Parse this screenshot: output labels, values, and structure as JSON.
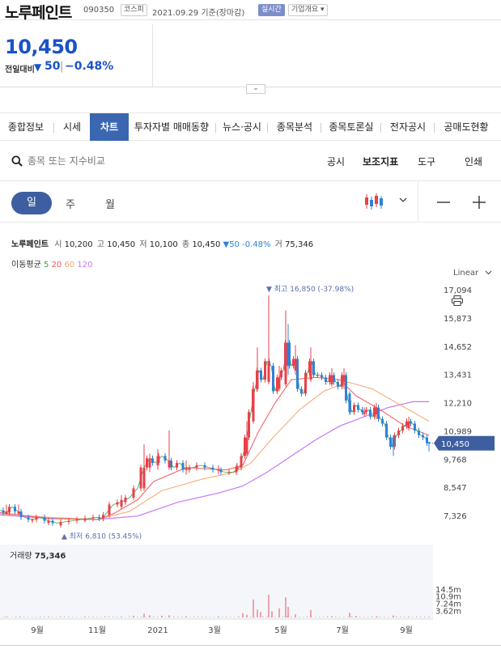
{
  "header": {
    "stock_name": "노루페인트",
    "stock_code": "090350",
    "market": "코스피",
    "date": "2021.09.29 기준(장마감)",
    "realtime": "실시간",
    "company_info": "기업개요 ▾"
  },
  "price": {
    "current": "10,450",
    "change_label": "전일대비",
    "change_arrow": "▼",
    "change_value": "50",
    "change_sep": "|",
    "change_rate": "−0.48%"
  },
  "expand_icon": "⌄",
  "tabs": [
    "종합정보",
    "시세",
    "차트",
    "투자자별 매매동향",
    "뉴스·공시",
    "종목분석",
    "종목토론실",
    "전자공시",
    "공매도현황"
  ],
  "active_tab": 2,
  "search": {
    "placeholder": "종목 또는 지수비교"
  },
  "toolbar": {
    "disclosure": "공시",
    "indicator": "보조지표",
    "tools": "도구",
    "print": "인쇄"
  },
  "periods": {
    "day": "일",
    "week": "주",
    "month": "월"
  },
  "chart_info": {
    "name": "노루페인트",
    "open_label": "시",
    "open": "10,200",
    "high_label": "고",
    "high": "10,450",
    "low_label": "저",
    "low": "10,100",
    "close_label": "종",
    "close": "10,450",
    "change": "▼50 -0.48%",
    "volume_label": "거",
    "volume": "75,346"
  },
  "ma_legend": {
    "label": "이동평균",
    "ma5": "5",
    "ma20": "20",
    "ma60": "60",
    "ma120": "120"
  },
  "scale": "Linear",
  "colors": {
    "up": "#e8414a",
    "down": "#2f82d6",
    "ma5": "#32b04a",
    "ma20": "#f0595f",
    "ma60": "#f4a56a",
    "ma120": "#c878f5",
    "accent": "#3b67b1",
    "price_blue": "#1a52c7"
  },
  "chart_data": {
    "type": "candlestick",
    "y_ticks": [
      "17,094",
      "15,873",
      "14,652",
      "13,431",
      "12,210",
      "10,989",
      "9,768",
      "8,547",
      "7,326"
    ],
    "ylim": [
      6500,
      17500
    ],
    "x_ticks": [
      "9월",
      "11월",
      "2021",
      "3월",
      "5월",
      "7월",
      "9월"
    ],
    "current_price_label": "10,450",
    "high_annotation": "▼ 최고 16,850 (-37.98%)",
    "low_annotation": "▲ 최저 6,810 (53.45%)",
    "volume_label": "거래량",
    "volume_value": "75,346",
    "volume_ticks": [
      "14.5m",
      "10.9m",
      "7.24m",
      "3.62m"
    ],
    "volume_max": 14500000,
    "close_path": [
      [
        0,
        7550
      ],
      [
        8,
        7450
      ],
      [
        15,
        7700
      ],
      [
        22,
        7500
      ],
      [
        30,
        7250
      ],
      [
        40,
        7150
      ],
      [
        50,
        7250
      ],
      [
        60,
        7100
      ],
      [
        70,
        7000
      ],
      [
        80,
        7050
      ],
      [
        90,
        7100
      ],
      [
        100,
        7150
      ],
      [
        110,
        7200
      ],
      [
        120,
        7250
      ],
      [
        125,
        7200
      ],
      [
        130,
        7350
      ],
      [
        140,
        7800
      ],
      [
        150,
        7900
      ],
      [
        160,
        8100
      ],
      [
        170,
        8500
      ],
      [
        178,
        9400
      ],
      [
        185,
        9800
      ],
      [
        192,
        9600
      ],
      [
        200,
        9900
      ],
      [
        208,
        9700
      ],
      [
        215,
        9400
      ],
      [
        222,
        9600
      ],
      [
        230,
        9300
      ],
      [
        238,
        9400
      ],
      [
        248,
        9500
      ],
      [
        258,
        9400
      ],
      [
        268,
        9300
      ],
      [
        278,
        9200
      ],
      [
        288,
        9200
      ],
      [
        296,
        9400
      ],
      [
        300,
        9900
      ],
      [
        305,
        10700
      ],
      [
        310,
        11800
      ],
      [
        315,
        12800
      ],
      [
        320,
        13600
      ],
      [
        325,
        13200
      ],
      [
        330,
        14000
      ],
      [
        335,
        13800
      ],
      [
        340,
        12700
      ],
      [
        345,
        13300
      ],
      [
        350,
        13600
      ],
      [
        355,
        14800
      ],
      [
        360,
        13800
      ],
      [
        365,
        14100
      ],
      [
        370,
        12800
      ],
      [
        375,
        12600
      ],
      [
        380,
        13500
      ],
      [
        385,
        14000
      ],
      [
        390,
        13400
      ],
      [
        395,
        13400
      ],
      [
        400,
        13300
      ],
      [
        405,
        13100
      ],
      [
        410,
        13400
      ],
      [
        415,
        13100
      ],
      [
        420,
        12900
      ],
      [
        425,
        13400
      ],
      [
        430,
        12300
      ],
      [
        435,
        11800
      ],
      [
        440,
        12100
      ],
      [
        445,
        11900
      ],
      [
        450,
        11800
      ],
      [
        455,
        11900
      ],
      [
        460,
        11600
      ],
      [
        465,
        12000
      ],
      [
        470,
        11500
      ],
      [
        475,
        11300
      ],
      [
        480,
        10700
      ],
      [
        485,
        10300
      ],
      [
        490,
        10800
      ],
      [
        495,
        11000
      ],
      [
        500,
        11200
      ],
      [
        505,
        11400
      ],
      [
        510,
        11300
      ],
      [
        515,
        11000
      ],
      [
        520,
        10800
      ],
      [
        525,
        10700
      ],
      [
        530,
        10450
      ]
    ],
    "ma20_path": [
      [
        0,
        7450
      ],
      [
        60,
        7200
      ],
      [
        120,
        7150
      ],
      [
        140,
        7400
      ],
      [
        170,
        8000
      ],
      [
        190,
        8800
      ],
      [
        230,
        9400
      ],
      [
        280,
        9300
      ],
      [
        300,
        9500
      ],
      [
        320,
        11000
      ],
      [
        340,
        12200
      ],
      [
        360,
        13200
      ],
      [
        390,
        13300
      ],
      [
        420,
        13200
      ],
      [
        440,
        12500
      ],
      [
        470,
        11900
      ],
      [
        500,
        11200
      ],
      [
        530,
        10800
      ]
    ],
    "ma60_path": [
      [
        0,
        7400
      ],
      [
        60,
        7250
      ],
      [
        120,
        7150
      ],
      [
        160,
        7500
      ],
      [
        200,
        8400
      ],
      [
        250,
        8900
      ],
      [
        290,
        9200
      ],
      [
        310,
        9600
      ],
      [
        340,
        10800
      ],
      [
        370,
        11900
      ],
      [
        400,
        12700
      ],
      [
        430,
        13100
      ],
      [
        460,
        12800
      ],
      [
        490,
        12200
      ],
      [
        530,
        11400
      ]
    ],
    "ma120_path": [
      [
        0,
        7350
      ],
      [
        60,
        7200
      ],
      [
        120,
        7150
      ],
      [
        170,
        7300
      ],
      [
        220,
        7900
      ],
      [
        270,
        8300
      ],
      [
        300,
        8600
      ],
      [
        330,
        9200
      ],
      [
        360,
        9900
      ],
      [
        390,
        10600
      ],
      [
        420,
        11200
      ],
      [
        450,
        11600
      ],
      [
        480,
        12000
      ],
      [
        510,
        12250
      ],
      [
        530,
        12250
      ]
    ],
    "candles": [
      [
        8,
        7400,
        7800,
        7350,
        7500
      ],
      [
        23,
        7400,
        7800,
        7350,
        7500
      ],
      [
        40,
        7100,
        7200,
        7000,
        7150
      ],
      [
        60,
        7000,
        7250,
        6900,
        7100
      ],
      [
        75,
        6900,
        7050,
        6810,
        7000
      ],
      [
        105,
        7100,
        7300,
        7050,
        7200
      ],
      [
        150,
        7700,
        8200,
        7600,
        8000
      ],
      [
        165,
        8100,
        8600,
        8000,
        8400
      ],
      [
        178,
        8500,
        10400,
        8400,
        9400
      ],
      [
        185,
        9400,
        10000,
        9200,
        9800
      ],
      [
        195,
        9500,
        10200,
        9300,
        9900
      ],
      [
        209,
        9400,
        11000,
        9300,
        9700
      ],
      [
        230,
        9300,
        9700,
        9100,
        9400
      ],
      [
        270,
        9300,
        9500,
        9100,
        9300
      ],
      [
        293,
        9300,
        9600,
        9200,
        9450
      ],
      [
        305,
        10000,
        11400,
        9900,
        10700
      ],
      [
        313,
        11400,
        13100,
        11300,
        12800
      ],
      [
        318,
        12800,
        14600,
        12700,
        13600
      ],
      [
        332,
        13100,
        16850,
        13000,
        14000
      ],
      [
        345,
        12800,
        13800,
        12700,
        13300
      ],
      [
        353,
        13000,
        16200,
        12900,
        14800
      ],
      [
        356,
        14800,
        15600,
        13400,
        13800
      ],
      [
        365,
        13600,
        14700,
        13400,
        14100
      ],
      [
        384,
        13200,
        14600,
        13100,
        14000
      ],
      [
        410,
        13000,
        13700,
        12900,
        13400
      ],
      [
        425,
        13100,
        13700,
        12800,
        13400
      ],
      [
        432,
        12600,
        12700,
        11700,
        11800
      ],
      [
        450,
        11700,
        12000,
        11600,
        11800
      ],
      [
        465,
        11700,
        12200,
        11500,
        12000
      ],
      [
        486,
        10700,
        10800,
        9900,
        10300
      ],
      [
        505,
        11100,
        11600,
        11000,
        11400
      ],
      [
        530,
        10500,
        10500,
        10100,
        10450
      ]
    ],
    "volumes": [
      [
        8,
        0.4
      ],
      [
        25,
        0.3
      ],
      [
        60,
        0.2
      ],
      [
        105,
        0.25
      ],
      [
        150,
        0.5
      ],
      [
        165,
        0.9
      ],
      [
        178,
        1.9
      ],
      [
        185,
        1.1
      ],
      [
        200,
        0.9
      ],
      [
        209,
        1.1
      ],
      [
        230,
        0.6
      ],
      [
        270,
        0.4
      ],
      [
        300,
        2.2
      ],
      [
        305,
        1.4
      ],
      [
        313,
        9.2
      ],
      [
        318,
        4.0
      ],
      [
        322,
        2.8
      ],
      [
        332,
        11.6
      ],
      [
        336,
        3.2
      ],
      [
        345,
        4.6
      ],
      [
        353,
        10.3
      ],
      [
        356,
        5.4
      ],
      [
        365,
        1.6
      ],
      [
        384,
        3.8
      ],
      [
        410,
        0.6
      ],
      [
        432,
        2.4
      ],
      [
        440,
        0.8
      ],
      [
        466,
        0.5
      ],
      [
        486,
        1.0
      ],
      [
        505,
        0.4
      ],
      [
        530,
        0.3
      ]
    ]
  }
}
